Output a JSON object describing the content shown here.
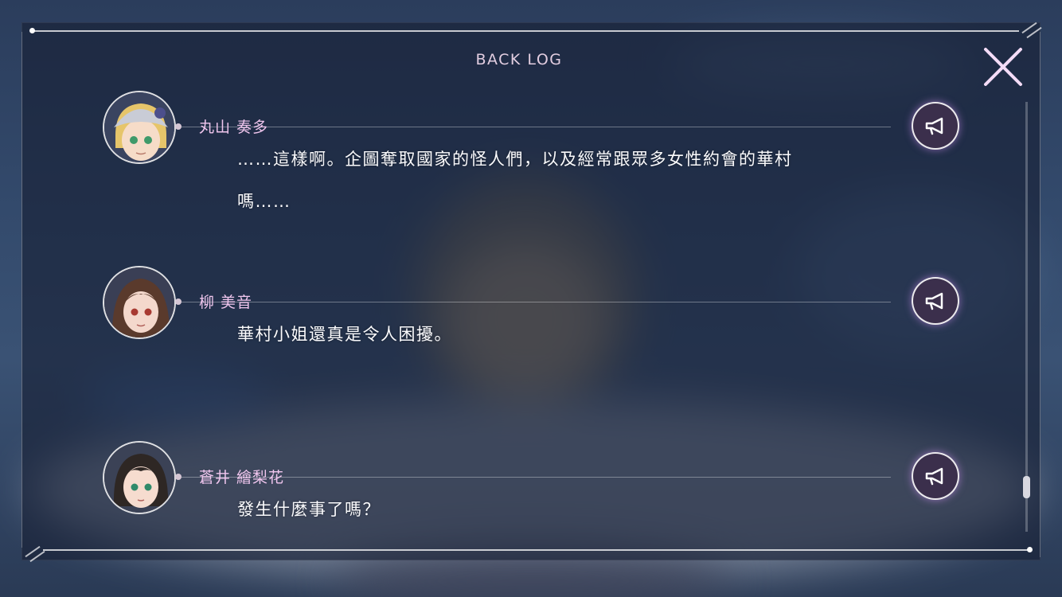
{
  "title": "BACK LOG",
  "entries": [
    {
      "name": "丸山 奏多",
      "lines": [
        "……這樣啊。企圖奪取國家的怪人們，以及經常跟眾多女性約會的華村",
        "嗎……"
      ]
    },
    {
      "name": "柳 美音",
      "lines": [
        "華村小姐還真是令人困擾。"
      ]
    },
    {
      "name": "蒼井 繪梨花",
      "lines": [
        "發生什麼事了嗎？"
      ]
    }
  ],
  "icons": {
    "close": "close-icon",
    "voice": "megaphone-icon"
  },
  "colors": {
    "name": "#f0c6ee",
    "voice_glow": "#dc96ff"
  }
}
